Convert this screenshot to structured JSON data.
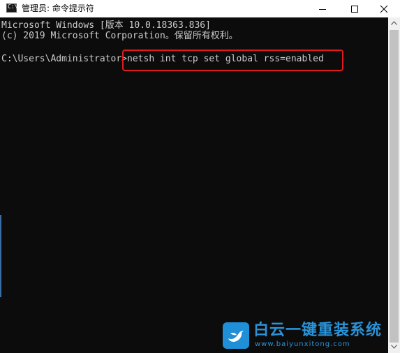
{
  "window": {
    "title": "管理员: 命令提示符",
    "icon": "cmd-icon",
    "controls": [
      "minimize-icon",
      "maximize-icon",
      "close-icon"
    ]
  },
  "console": {
    "lines": [
      "Microsoft Windows [版本 10.0.18363.836]",
      "(c) 2019 Microsoft Corporation。保留所有权利。"
    ],
    "prompt": "C:\\Users\\Administrator>",
    "command": "netsh int tcp set global rss=enabled"
  },
  "highlight": {
    "color": "#e11b1b",
    "target": "command"
  },
  "watermark": {
    "title": "白云一键重装系统",
    "url": "www.baiyunxitong.com",
    "icon": "bird-logo-icon",
    "color": "#2a93d8"
  },
  "colors": {
    "console_background": "#0c0c0c",
    "console_text": "#cccccc",
    "titlebar_background": "#ffffff"
  }
}
